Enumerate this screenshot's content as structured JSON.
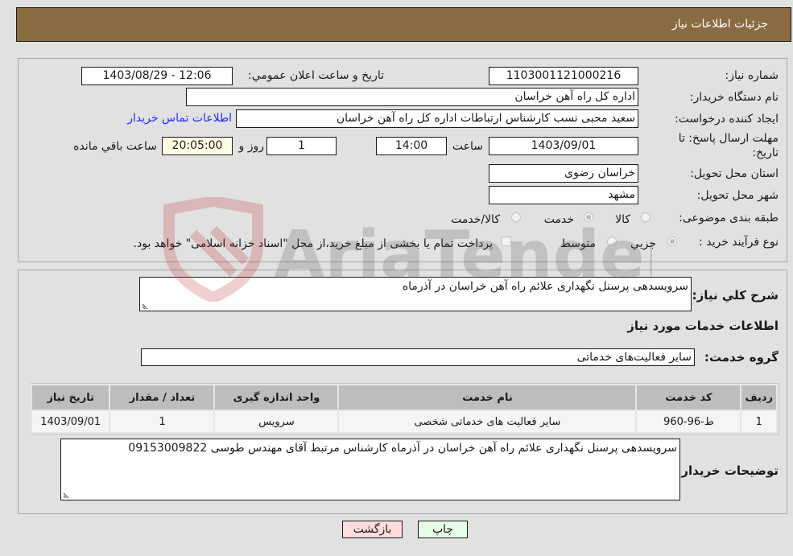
{
  "header": {
    "title": "جزئیات اطلاعات نیاز"
  },
  "fields": {
    "need_number_label": "شماره نیاز:",
    "need_number": "1103001121000216",
    "announce_label": "تاریخ و ساعت اعلان عمومي:",
    "announce_value": "1403/08/29 - 12:06",
    "buyer_org_label": "نام دستگاه خریدار:",
    "buyer_org": "اداره کل راه آهن خراسان",
    "creator_label": "ایجاد کننده درخواست:",
    "creator": "سعید محبی نسب کارشناس ارتباطات اداره کل راه آهن خراسان",
    "contact_link": "اطلاعات تماس خریدار",
    "deadline_label_1": "مهلت ارسال پاسخ: تا",
    "deadline_label_2": "تاریخ:",
    "deadline_date": "1403/09/01",
    "time_label": "ساعت",
    "deadline_time": "14:00",
    "days_value": "1",
    "days_label": "روز و",
    "remaining_time": "20:05:00",
    "remaining_label": "ساعت باقي مانده",
    "province_label": "استان محل تحویل:",
    "province": "خراسان رضوی",
    "city_label": "شهر محل تحویل:",
    "city": "مشهد",
    "category_label": "طبقه بندی موضوعی:",
    "category_options": [
      {
        "label": "کالا",
        "selected": false
      },
      {
        "label": "خدمت",
        "selected": true
      },
      {
        "label": "کالا/خدمت",
        "selected": false
      }
    ],
    "process_label": "نوع فرآیند خرید :",
    "process_options": [
      {
        "label": "جزيي",
        "selected": true
      },
      {
        "label": "متوسط",
        "selected": false
      }
    ],
    "treasury_note": "پرداخت تمام یا بخشی از مبلغ خرید،از محل \"اسناد خزانه اسلامی\" خواهد بود."
  },
  "summary": {
    "general_desc_label": "شرح كلي نیاز:",
    "general_desc": "سرویسدهی پرسنل نگهداری علائم راه آهن خراسان در آذرماه",
    "services_info_title": "اطلاعات خدمات مورد نیاز",
    "service_group_label": "گروه خدمت:",
    "service_group": "سایر فعالیت‌های خدماتی"
  },
  "table": {
    "headers": [
      "ردیف",
      "کد خدمت",
      "نام خدمت",
      "واحد اندازه گیری",
      "تعداد / مقدار",
      "تاریخ نیاز"
    ],
    "rows": [
      [
        "1",
        "ط-96-960",
        "سایر فعالیت های خدماتی شخصی",
        "سرویس",
        "1",
        "1403/09/01"
      ]
    ]
  },
  "buyer_notes": {
    "label": "توضیحات خریدار:",
    "text": "سرویسدهی پرسنل نگهداری علائم راه آهن خراسان در آذرماه کارشناس مرتبط آقای مهندس طوسی 09153009822"
  },
  "buttons": {
    "print": "چاپ",
    "back": "بازگشت"
  },
  "colors": {
    "header_bg": "#8b6c42",
    "print_bg": "#e6ffe6",
    "back_bg": "#ffdddd",
    "link": "#2a2aff"
  },
  "watermark": {
    "text": "AriaTender.neT"
  }
}
